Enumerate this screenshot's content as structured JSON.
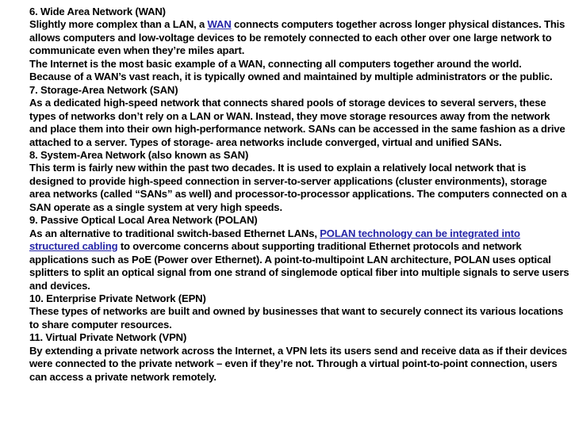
{
  "document": {
    "background_color": "#ffffff",
    "text_color": "#000000",
    "link_color": "#2626A8",
    "lines": [
      {
        "id": "l1",
        "text": "6. Wide Area Network (WAN)"
      },
      {
        "id": "l2",
        "pre": "Slightly more complex than a LAN, a ",
        "link": "WAN",
        "post": " connects computers together across longer physical distances. This"
      },
      {
        "id": "l3",
        "text": "allows computers and low-voltage devices to be remotely connected to each other over one large network to"
      },
      {
        "id": "l4",
        "text": "communicate even when they’re miles apart."
      },
      {
        "id": "l5",
        "text": "The Internet is the most basic example of a WAN, connecting all computers together around the world."
      },
      {
        "id": "l6",
        "text": "Because of a WAN’s vast reach, it is typically owned and maintained by multiple administrators or the public."
      },
      {
        "id": "l7",
        "text": "7. Storage-Area Network (SAN)"
      },
      {
        "id": "l8",
        "text": "As a dedicated high-speed network that connects shared pools of storage devices to several servers, these"
      },
      {
        "id": "l9",
        "text": "types of networks don’t rely on a LAN or WAN. Instead, they move storage resources away from the network"
      },
      {
        "id": "l10",
        "text": "and place them into their own high-performance network. SANs can be accessed in the same fashion as a drive"
      },
      {
        "id": "l11",
        "text": "attached to a server. Types of storage- area networks include converged, virtual and unified SANs."
      },
      {
        "id": "l12",
        "text": "8. System-Area Network (also known as SAN)"
      },
      {
        "id": "l13",
        "text": "This term is fairly new within the past two decades. It is used to explain a relatively local network that is"
      },
      {
        "id": "l14",
        "text": "designed to provide high-speed connection in server-to-server applications (cluster environments), storage"
      },
      {
        "id": "l15",
        "text": "area networks (called “SANs” as well) and processor-to-processor applications. The computers connected on a"
      },
      {
        "id": "l16",
        "text": "SAN operate as a single system at very high speeds."
      },
      {
        "id": "l17",
        "text": "9. Passive Optical Local Area Network (POLAN)"
      },
      {
        "id": "l18",
        "pre": "As an alternative to traditional switch-based Ethernet LANs, ",
        "link": "POLAN technology can be integrated into",
        "post": ""
      },
      {
        "id": "l19",
        "link": "structured cabling",
        "post": " to overcome concerns about supporting traditional Ethernet protocols and network"
      },
      {
        "id": "l20",
        "text": "applications such as PoE (Power over Ethernet). A point-to-multipoint LAN architecture, POLAN uses optical"
      },
      {
        "id": "l21",
        "text": "splitters to split an optical signal from one strand of singlemode optical fiber into multiple signals to serve users"
      },
      {
        "id": "l22",
        "text": "and devices."
      },
      {
        "id": "l23",
        "text": "10. Enterprise Private Network (EPN)"
      },
      {
        "id": "l24",
        "text": "These types of networks are built and owned by businesses that want to securely connect its various locations"
      },
      {
        "id": "l25",
        "text": "to share computer resources."
      },
      {
        "id": "l26",
        "text": "11. Virtual Private Network (VPN)"
      },
      {
        "id": "l27",
        "text": "By extending a private network across the Internet, a VPN lets its users send and receive data as if their devices"
      },
      {
        "id": "l28",
        "text": "were connected to the private network – even if they’re not. Through a virtual point-to-point connection, users"
      },
      {
        "id": "l29",
        "text": "can access a private network remotely."
      }
    ]
  }
}
